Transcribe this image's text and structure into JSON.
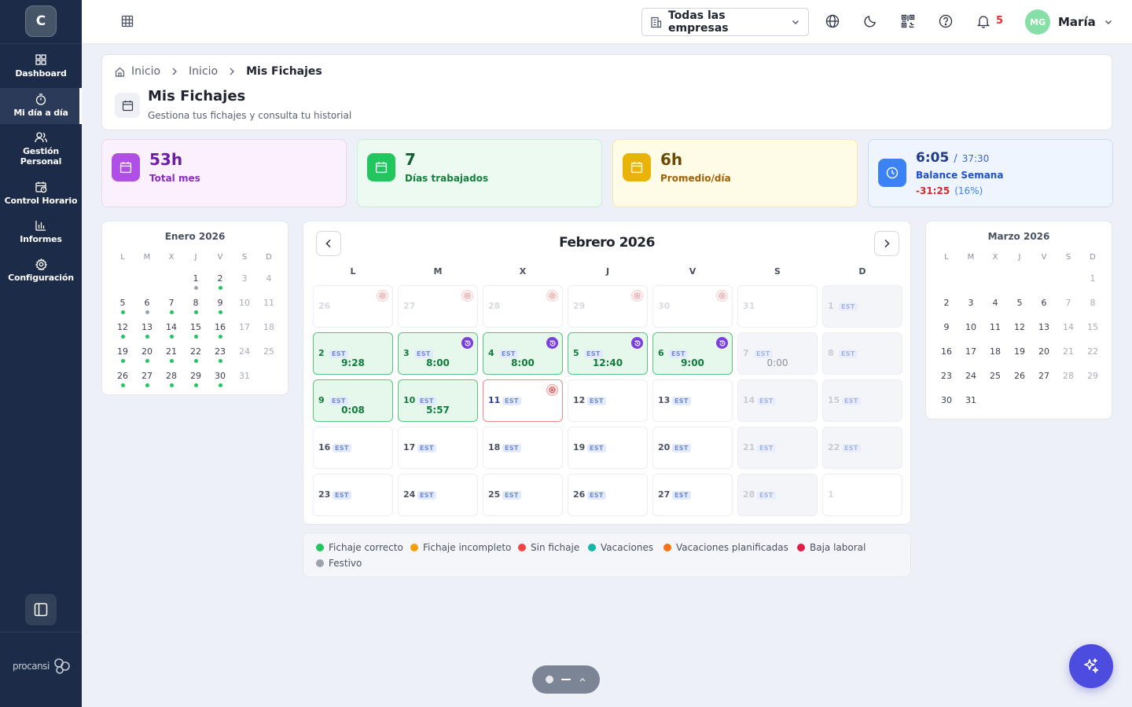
{
  "sidebar": {
    "logo_letter": "C",
    "items": [
      {
        "label": "Dashboard",
        "icon": "grid-icon"
      },
      {
        "label": "Mi día a día",
        "icon": "timer-icon",
        "active": true
      },
      {
        "label": "Gestión Personal",
        "icon": "users-icon"
      },
      {
        "label": "Control Horario",
        "icon": "calendar-clock-icon"
      },
      {
        "label": "Informes",
        "icon": "bar-chart-icon"
      },
      {
        "label": "Configuración",
        "icon": "gear-icon"
      }
    ],
    "brand": "procansi"
  },
  "topbar": {
    "company_select": "Todas las empresas",
    "notifications_count": "5",
    "user_initials": "MG",
    "user_name": "María"
  },
  "header": {
    "breadcrumb": [
      "Inicio",
      "Inicio",
      "Mis Fichajes"
    ],
    "title": "Mis Fichajes",
    "subtitle": "Gestiona tus fichajes y consulta tu historial"
  },
  "stats": {
    "total_mes": {
      "value": "53h",
      "label": "Total mes"
    },
    "dias_trabajados": {
      "value": "7",
      "label": "Días trabajados"
    },
    "promedio": {
      "value": "6h",
      "label": "Promedio/día"
    },
    "balance": {
      "value": "6:05",
      "target": "37:30",
      "label": "Balance Semana",
      "diff": "-31:25",
      "percent": "(16%)"
    }
  },
  "colors": {
    "correcto": "#22c55e",
    "incompleto": "#f59e0b",
    "sin_fichaje": "#ef4444",
    "vacaciones": "#14b8a6",
    "vacaciones_planificadas": "#f97316",
    "baja": "#e11d48",
    "festivo": "#9ca3af"
  },
  "weekdays": [
    "L",
    "M",
    "X",
    "J",
    "V",
    "S",
    "D"
  ],
  "mini_prev": {
    "title": "Enero 2026",
    "offset": 3,
    "days": 31,
    "dots": {
      "1": "festivo",
      "2": "correcto",
      "5": "correcto",
      "6": "festivo",
      "7": "correcto",
      "8": "correcto",
      "9": "correcto",
      "12": "correcto",
      "13": "correcto",
      "14": "correcto",
      "15": "correcto",
      "16": "correcto",
      "19": "correcto",
      "20": "correcto",
      "21": "correcto",
      "22": "correcto",
      "23": "correcto",
      "26": "correcto",
      "27": "correcto",
      "28": "correcto",
      "29": "correcto",
      "30": "correcto"
    }
  },
  "mini_next": {
    "title": "Marzo 2026",
    "offset": 6,
    "days": 31,
    "dots": {}
  },
  "main_calendar": {
    "title": "Febrero 2026",
    "headers": [
      "L",
      "M",
      "X",
      "J",
      "V",
      "S",
      "D"
    ],
    "est_label": "EST",
    "cells": [
      {
        "day": "26",
        "type": "other",
        "badge": "x"
      },
      {
        "day": "27",
        "type": "other",
        "badge": "x"
      },
      {
        "day": "28",
        "type": "other",
        "badge": "x"
      },
      {
        "day": "29",
        "type": "other",
        "badge": "x"
      },
      {
        "day": "30",
        "type": "other",
        "badge": "x"
      },
      {
        "day": "31",
        "type": "other"
      },
      {
        "day": "1",
        "type": "weekend",
        "est": true
      },
      {
        "day": "2",
        "type": "worked",
        "est": true,
        "time": "9:28"
      },
      {
        "day": "3",
        "type": "worked",
        "est": true,
        "time": "8:00",
        "badge": "r"
      },
      {
        "day": "4",
        "type": "worked",
        "est": true,
        "time": "8:00",
        "badge": "r"
      },
      {
        "day": "5",
        "type": "worked",
        "est": true,
        "time": "12:40",
        "badge": "r"
      },
      {
        "day": "6",
        "type": "worked",
        "est": true,
        "time": "9:00",
        "badge": "r"
      },
      {
        "day": "7",
        "type": "weekend",
        "est": true,
        "time": "0:00"
      },
      {
        "day": "8",
        "type": "weekend",
        "est": true
      },
      {
        "day": "9",
        "type": "worked",
        "est": true,
        "time": "0:08"
      },
      {
        "day": "10",
        "type": "worked",
        "est": true,
        "time": "5:57"
      },
      {
        "day": "11",
        "type": "missing",
        "est": true,
        "badge": "x"
      },
      {
        "day": "12",
        "type": "normal",
        "est": true
      },
      {
        "day": "13",
        "type": "normal",
        "est": true
      },
      {
        "day": "14",
        "type": "weekend",
        "est": true
      },
      {
        "day": "15",
        "type": "weekend",
        "est": true
      },
      {
        "day": "16",
        "type": "normal",
        "est": true
      },
      {
        "day": "17",
        "type": "normal",
        "est": true
      },
      {
        "day": "18",
        "type": "normal",
        "est": true
      },
      {
        "day": "19",
        "type": "normal",
        "est": true
      },
      {
        "day": "20",
        "type": "normal",
        "est": true
      },
      {
        "day": "21",
        "type": "weekend",
        "est": true
      },
      {
        "day": "22",
        "type": "weekend",
        "est": true
      },
      {
        "day": "23",
        "type": "normal",
        "est": true
      },
      {
        "day": "24",
        "type": "normal",
        "est": true
      },
      {
        "day": "25",
        "type": "normal",
        "est": true
      },
      {
        "day": "26",
        "type": "normal",
        "est": true
      },
      {
        "day": "27",
        "type": "normal",
        "est": true
      },
      {
        "day": "28",
        "type": "weekend",
        "est": true
      },
      {
        "day": "1",
        "type": "other"
      }
    ]
  },
  "legend": [
    {
      "label": "Fichaje correcto",
      "color": "#22c55e"
    },
    {
      "label": "Fichaje incompleto",
      "color": "#f59e0b"
    },
    {
      "label": "Sin fichaje",
      "color": "#ef4444"
    },
    {
      "label": "Vacaciones",
      "color": "#14b8a6"
    },
    {
      "label": "Vacaciones planificadas",
      "color": "#f97316"
    },
    {
      "label": "Baja laboral",
      "color": "#e11d48"
    },
    {
      "label": "Festivo",
      "color": "#9ca3af"
    }
  ]
}
